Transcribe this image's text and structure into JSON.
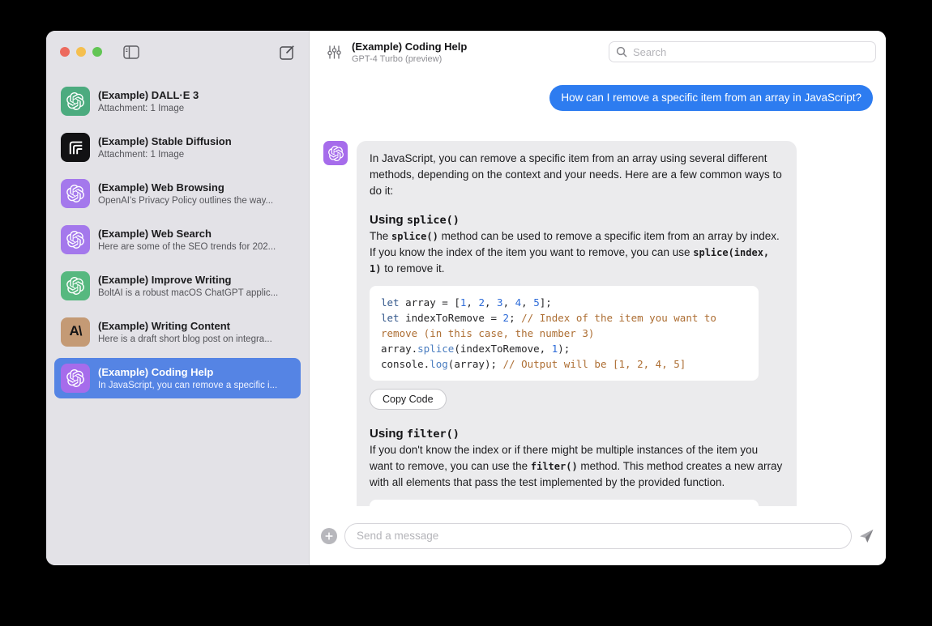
{
  "colors": {
    "traffic_red": "#ec6a5e",
    "traffic_yellow": "#f5bf4f",
    "traffic_green": "#62c554",
    "accent": "#2d7cf0",
    "selected_blue": "#5584e4"
  },
  "icons": {
    "anthropic_glyph": "A\\"
  },
  "sidebar": {
    "items": [
      {
        "title": "(Example) DALL·E 3",
        "subtitle": "Attachment: 1 Image",
        "icon": "openai",
        "icon_bg": "#4cab7f"
      },
      {
        "title": "(Example) Stable Diffusion",
        "subtitle": "Attachment: 1 Image",
        "icon": "stability",
        "icon_bg": "#121214"
      },
      {
        "title": "(Example) Web Browsing",
        "subtitle": "OpenAI's Privacy Policy outlines the way...",
        "icon": "openai",
        "icon_bg": "#a478ec"
      },
      {
        "title": "(Example) Web Search",
        "subtitle": "Here are some of the SEO trends for 202...",
        "icon": "openai",
        "icon_bg": "#a478ec"
      },
      {
        "title": "(Example) Improve Writing",
        "subtitle": "BoltAI is a robust macOS ChatGPT applic...",
        "icon": "openai",
        "icon_bg": "#56b87f"
      },
      {
        "title": "(Example) Writing Content",
        "subtitle": "Here is a draft short blog post on integra...",
        "icon": "anthropic",
        "icon_bg": "#c49a75"
      },
      {
        "title": "(Example) Coding Help",
        "subtitle": "In JavaScript, you can remove a specific i...",
        "icon": "openai",
        "icon_bg": "#a66ceb",
        "state": "selected",
        "bg": "#5584e4"
      }
    ]
  },
  "header": {
    "title": "(Example) Coding Help",
    "subtitle": "GPT-4 Turbo (preview)",
    "search_placeholder": "Search"
  },
  "chat": {
    "user_message": "How can I remove a specific item from an array in JavaScript?",
    "assistant": {
      "intro": "In JavaScript, you can remove a specific item from an array using several different methods, depending on the context and your needs. Here are a few common ways to do it:",
      "heading1": [
        {
          "t": "Using ",
          "c": "ht"
        },
        {
          "t": "splice()",
          "c": "hcode"
        }
      ],
      "para1": [
        {
          "t": "The ",
          "c": "t"
        },
        {
          "t": "splice()",
          "c": "code"
        },
        {
          "t": " method can be used to remove a specific item from an array by index. If you know the index of the item you want to remove, you can use ",
          "c": "t"
        },
        {
          "t": "splice(index, 1)",
          "c": "code"
        },
        {
          "t": " to remove it.",
          "c": "t"
        }
      ],
      "code1": {
        "lines": [
          {
            "tokens": [
              {
                "t": "let ",
                "c": "kw"
              },
              {
                "t": "array = [",
                "c": "pl"
              },
              {
                "t": "1",
                "c": "num"
              },
              {
                "t": ", ",
                "c": "pl"
              },
              {
                "t": "2",
                "c": "num"
              },
              {
                "t": ", ",
                "c": "pl"
              },
              {
                "t": "3",
                "c": "num"
              },
              {
                "t": ", ",
                "c": "pl"
              },
              {
                "t": "4",
                "c": "num"
              },
              {
                "t": ", ",
                "c": "pl"
              },
              {
                "t": "5",
                "c": "num"
              },
              {
                "t": "];",
                "c": "pl"
              }
            ]
          },
          {
            "tokens": [
              {
                "t": "let ",
                "c": "kw"
              },
              {
                "t": "indexToRemove = ",
                "c": "pl"
              },
              {
                "t": "2",
                "c": "num"
              },
              {
                "t": "; ",
                "c": "pl"
              },
              {
                "t": "// Index of the item you want to remove (in this case, the number 3)",
                "c": "cm"
              }
            ]
          },
          {
            "tokens": [
              {
                "t": "array.",
                "c": "pl"
              },
              {
                "t": "splice",
                "c": "fn"
              },
              {
                "t": "(indexToRemove, ",
                "c": "pl"
              },
              {
                "t": "1",
                "c": "num"
              },
              {
                "t": ");",
                "c": "pl"
              }
            ]
          },
          {
            "tokens": [
              {
                "t": "console.",
                "c": "pl"
              },
              {
                "t": "log",
                "c": "fn"
              },
              {
                "t": "(array); ",
                "c": "pl"
              },
              {
                "t": "// Output will be [1, 2, 4, 5]",
                "c": "cm"
              }
            ]
          }
        ]
      },
      "copy_button": "Copy Code",
      "heading2": [
        {
          "t": "Using ",
          "c": "ht"
        },
        {
          "t": "filter()",
          "c": "hcode"
        }
      ],
      "para2": [
        {
          "t": "If you don't know the index or if there might be multiple instances of the item you want to remove, you can use the ",
          "c": "t"
        },
        {
          "t": "filter()",
          "c": "code"
        },
        {
          "t": " method. This method creates a new array with all elements that pass the test implemented by the provided function.",
          "c": "t"
        }
      ]
    }
  },
  "composer": {
    "placeholder": "Send a message",
    "plus_label": "+"
  }
}
